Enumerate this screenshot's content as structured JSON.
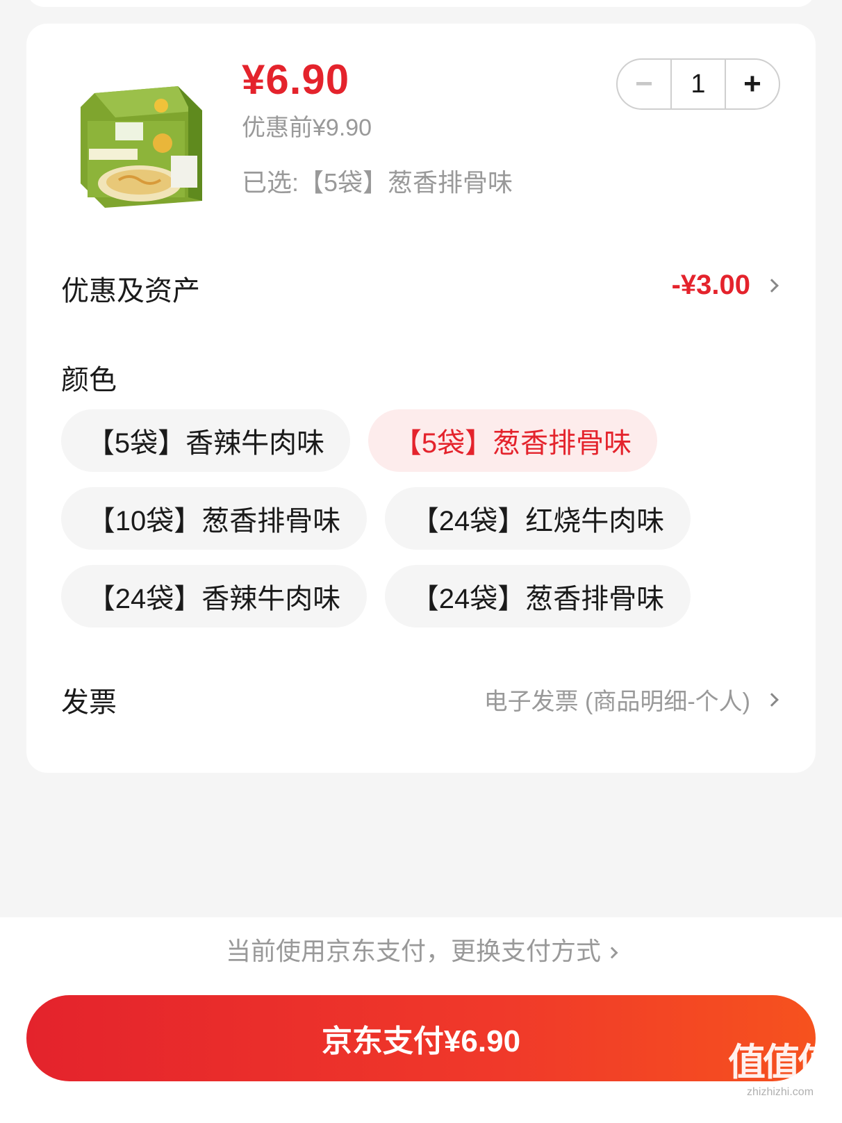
{
  "product": {
    "image_icon": "instant-noodle-package-image",
    "price": "¥6.90",
    "original_price": "优惠前¥9.90",
    "selected": "已选:【5袋】葱香排骨味",
    "quantity": "1",
    "minus_label": "−",
    "plus_label": "+"
  },
  "discount": {
    "label": "优惠及资产",
    "value": "-¥3.00"
  },
  "color": {
    "label": "颜色",
    "options": [
      {
        "label": "【5袋】香辣牛肉味",
        "selected": false
      },
      {
        "label": "【5袋】葱香排骨味",
        "selected": true
      },
      {
        "label": "【10袋】葱香排骨味",
        "selected": false
      },
      {
        "label": "【24袋】红烧牛肉味",
        "selected": false
      },
      {
        "label": "【24袋】香辣牛肉味",
        "selected": false
      },
      {
        "label": "【24袋】葱香排骨味",
        "selected": false
      }
    ]
  },
  "invoice": {
    "label": "发票",
    "value": "电子发票 (商品明细-个人)"
  },
  "payment": {
    "method_text": "当前使用京东支付，更换支付方式",
    "button_label": "京东支付¥6.90"
  },
  "watermark": {
    "big": "值值值",
    "small": "zhizhizhi.com"
  },
  "colors": {
    "accent": "#e4232c",
    "selected_chip_bg": "#fdecec",
    "chip_bg": "#f5f5f5",
    "muted_text": "#999999"
  }
}
